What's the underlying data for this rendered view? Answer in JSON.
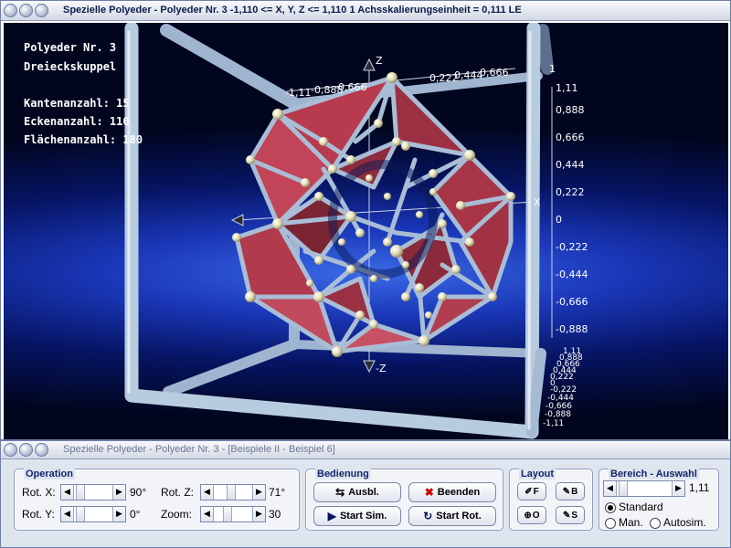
{
  "main_window": {
    "title": "Spezielle Polyeder - Polyeder Nr. 3   -1,110 <= X, Y, Z <= 1,110     1 Achsskalierungseinheit = 0,111 LE"
  },
  "info": {
    "line1": "Polyeder Nr. 3",
    "line2": "Dreieckskuppel",
    "edges": "Kantenanzahl: 15",
    "corners": "Eckenanzahl: 110",
    "faces": "Flächenanzahl: 180"
  },
  "axes": {
    "x_label": "X",
    "z_label": "Z",
    "neg_z_label": "-Z",
    "top_ticks": [
      "-1,11",
      "-0,888",
      "-0,666",
      "0,222",
      "0,444",
      "0,666",
      "1"
    ],
    "right_ticks": [
      "1,11",
      "0,888",
      "0,666",
      "0,444",
      "0,222",
      "0",
      "-0,222",
      "-0,444",
      "-0,666",
      "-0,888"
    ],
    "corner_ticks": [
      "1,11",
      "0,888",
      "0,666",
      "0,444",
      "0,222",
      "0",
      "-0,222",
      "-0,444",
      "-0,666",
      "-0,888",
      "-1,11"
    ]
  },
  "control_window": {
    "title": "Spezielle Polyeder - Polyeder Nr. 3 - [Beispiele II - Beispiel 6]"
  },
  "operation": {
    "title": "Operation",
    "rot_x_label": "Rot. X:",
    "rot_x_value": "90°",
    "rot_y_label": "Rot. Y:",
    "rot_y_value": "0°",
    "rot_z_label": "Rot. Z:",
    "rot_z_value": "71°",
    "zoom_label": "Zoom:",
    "zoom_value": "30"
  },
  "bedienung": {
    "title": "Bedienung",
    "ausbl": "Ausbl.",
    "beenden": "Beenden",
    "start_sim": "Start Sim.",
    "start_rot": "Start Rot."
  },
  "layout": {
    "title": "Layout",
    "b1": "F",
    "b2": "B",
    "b3": "O",
    "b4": "S"
  },
  "bereich": {
    "title": "Bereich - Auswahl",
    "value": "1,11",
    "standard": "Standard",
    "man": "Man.",
    "autosim": "Autosim.",
    "selected": "standard"
  },
  "colors": {
    "face": "#b73a4e",
    "face_dark": "#6e1d2b",
    "edge": "#a9bdd6",
    "vertex": "#e8e4c0",
    "frame": "#b8cce0"
  }
}
